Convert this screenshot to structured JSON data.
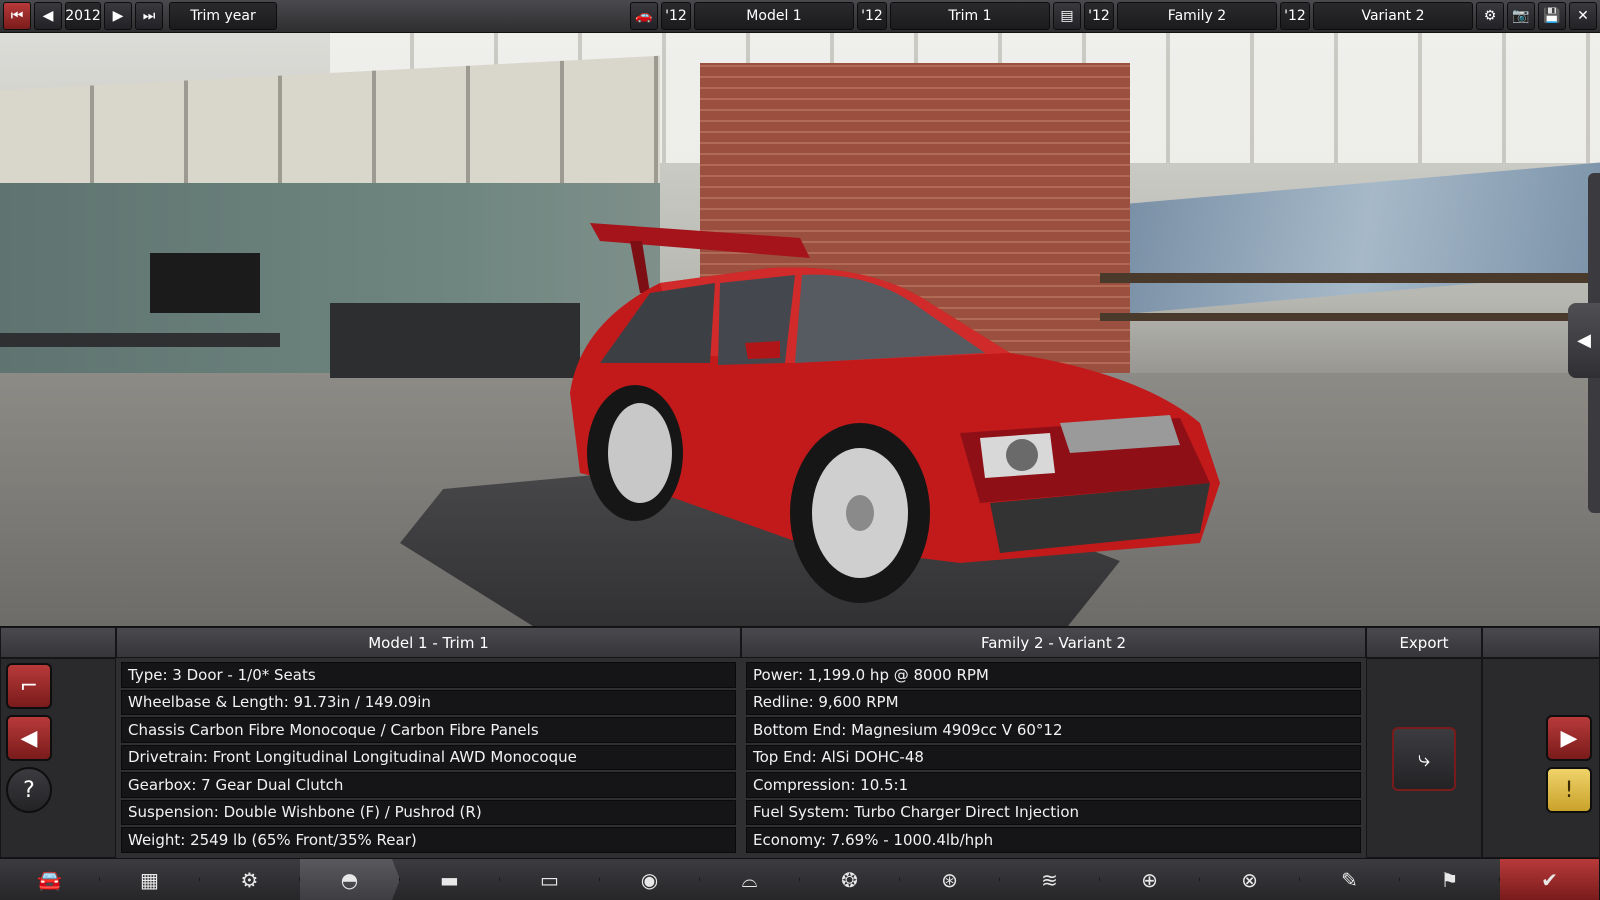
{
  "topbar": {
    "year": "2012",
    "trim_year_label": "Trim year",
    "model_year": "'12",
    "model_name": "Model 1",
    "trim_year": "'12",
    "trim_name": "Trim 1",
    "family_year": "'12",
    "family_name": "Family 2",
    "variant_year": "'12",
    "variant_name": "Variant 2"
  },
  "panel": {
    "left_title": "Model 1 - Trim 1",
    "right_title": "Family 2 - Variant 2",
    "export_label": "Export",
    "car_specs": [
      "Type: 3 Door - 1/0* Seats",
      "Wheelbase & Length: 91.73in / 149.09in",
      "Chassis Carbon Fibre Monocoque / Carbon Fibre Panels",
      "Drivetrain: Front Longitudinal Longitudinal AWD Monocoque",
      "Gearbox: 7 Gear Dual Clutch",
      "Suspension: Double Wishbone (F) / Pushrod (R)",
      "Weight: 2549 lb (65% Front/35% Rear)"
    ],
    "engine_specs": [
      "Power: 1,199.0 hp @ 8000 RPM",
      "Redline:  9,600 RPM",
      "Bottom End: Magnesium 4909cc V 60°12",
      "Top End: AlSi DOHC-48",
      "Compression: 10.5:1",
      "Fuel System: Turbo Charger Direct Injection",
      "Economy: 7.69% - 1000.4lb/hph"
    ]
  },
  "colors": {
    "accent_red": "#b83a3a",
    "warning_yellow": "#e8c44a",
    "car_red": "#c21a1a"
  },
  "icons": {
    "bottom_nav": [
      "car-body-icon",
      "chassis-icon",
      "suspension-icon",
      "body-shape-icon",
      "fixtures-icon",
      "trim-icon",
      "engine-icon",
      "gearbox-icon",
      "wheels-icon",
      "brakes-icon",
      "aero-icon",
      "interior-icon",
      "steering-icon",
      "tuning-icon",
      "testing-icon",
      "finish-icon"
    ]
  }
}
